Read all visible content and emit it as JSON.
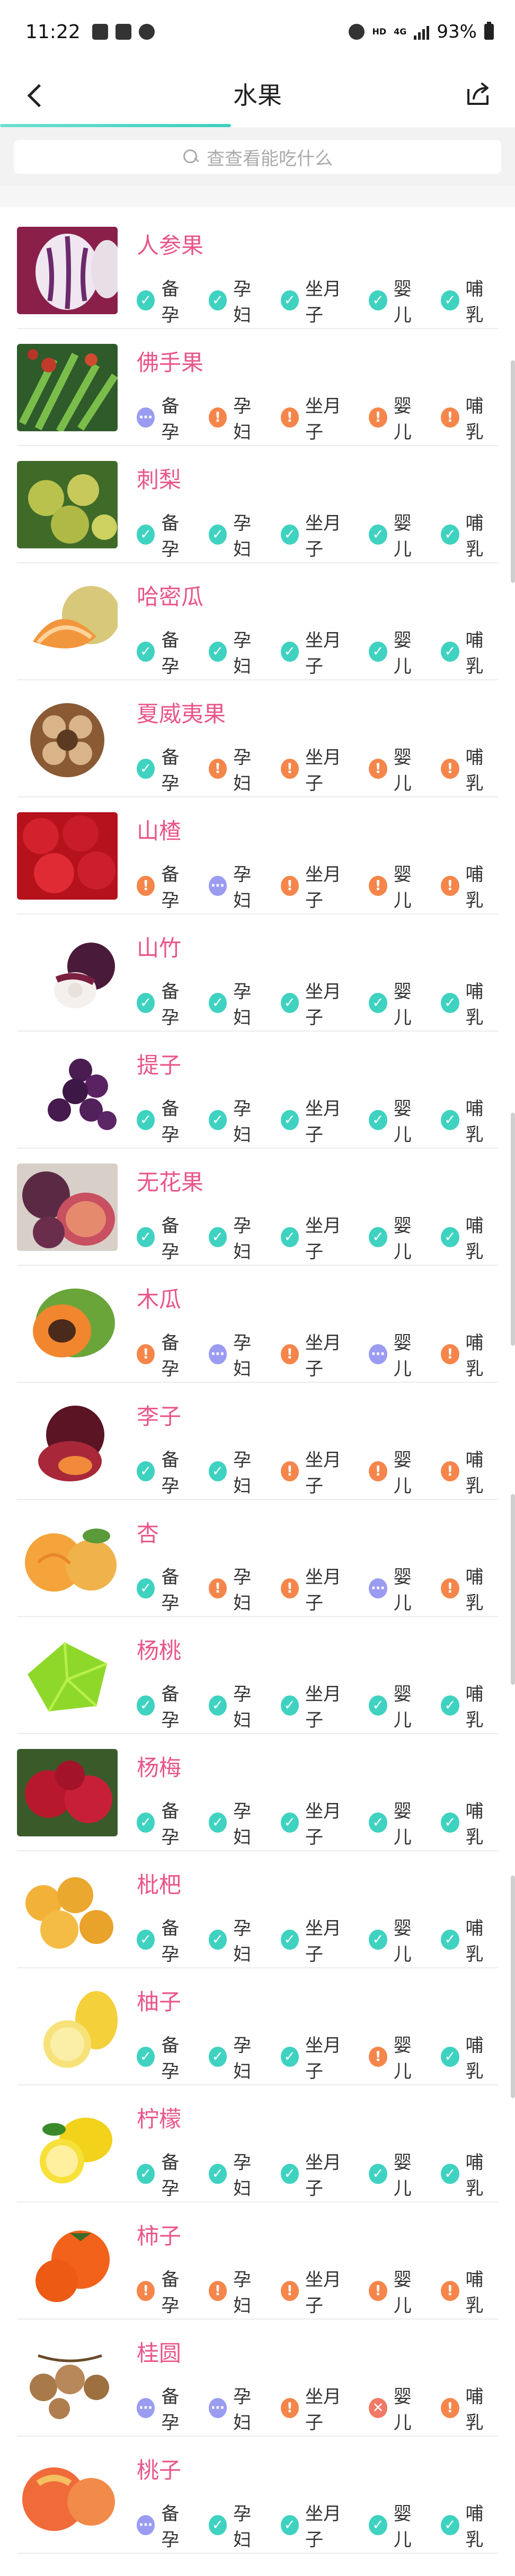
{
  "status_bar": {
    "time": "11:22",
    "network": "HD",
    "network_type": "4G",
    "battery": "93%"
  },
  "nav": {
    "title": "水果",
    "back_icon": "chevron-left-icon",
    "share_icon": "share-icon"
  },
  "search": {
    "placeholder": "查查看能吃什么"
  },
  "status_legend": {
    "ok": {
      "icon": "check-icon",
      "color": "#3fd2c0"
    },
    "warn": {
      "icon": "exclamation-icon",
      "color": "#f5864b"
    },
    "cau": {
      "icon": "ellipsis-icon",
      "color": "#9a9cf2"
    },
    "no": {
      "icon": "cross-icon",
      "color": "#f07a66"
    }
  },
  "categories": [
    "备孕",
    "孕妇",
    "坐月子",
    "婴儿",
    "哺乳"
  ],
  "items": [
    {
      "name": "人参果",
      "statuses": [
        "ok",
        "ok",
        "ok",
        "ok",
        "ok"
      ]
    },
    {
      "name": "佛手果",
      "statuses": [
        "cau",
        "warn",
        "warn",
        "warn",
        "warn"
      ]
    },
    {
      "name": "刺梨",
      "statuses": [
        "ok",
        "ok",
        "ok",
        "ok",
        "ok"
      ]
    },
    {
      "name": "哈密瓜",
      "statuses": [
        "ok",
        "ok",
        "ok",
        "ok",
        "ok"
      ]
    },
    {
      "name": "夏威夷果",
      "statuses": [
        "ok",
        "warn",
        "warn",
        "warn",
        "warn"
      ]
    },
    {
      "name": "山楂",
      "statuses": [
        "warn",
        "cau",
        "warn",
        "warn",
        "warn"
      ]
    },
    {
      "name": "山竹",
      "statuses": [
        "ok",
        "ok",
        "ok",
        "ok",
        "ok"
      ]
    },
    {
      "name": "提子",
      "statuses": [
        "ok",
        "ok",
        "ok",
        "ok",
        "ok"
      ]
    },
    {
      "name": "无花果",
      "statuses": [
        "ok",
        "ok",
        "ok",
        "ok",
        "ok"
      ]
    },
    {
      "name": "木瓜",
      "statuses": [
        "warn",
        "cau",
        "warn",
        "cau",
        "warn"
      ]
    },
    {
      "name": "李子",
      "statuses": [
        "ok",
        "ok",
        "warn",
        "warn",
        "warn"
      ]
    },
    {
      "name": "杏",
      "statuses": [
        "ok",
        "warn",
        "warn",
        "cau",
        "warn"
      ]
    },
    {
      "name": "杨桃",
      "statuses": [
        "ok",
        "ok",
        "ok",
        "ok",
        "ok"
      ]
    },
    {
      "name": "杨梅",
      "statuses": [
        "ok",
        "ok",
        "ok",
        "ok",
        "ok"
      ]
    },
    {
      "name": "枇杷",
      "statuses": [
        "ok",
        "ok",
        "ok",
        "ok",
        "ok"
      ]
    },
    {
      "name": "柚子",
      "statuses": [
        "ok",
        "ok",
        "ok",
        "warn",
        "ok"
      ]
    },
    {
      "name": "柠檬",
      "statuses": [
        "ok",
        "ok",
        "ok",
        "ok",
        "ok"
      ]
    },
    {
      "name": "柿子",
      "statuses": [
        "warn",
        "warn",
        "warn",
        "warn",
        "warn"
      ]
    },
    {
      "name": "桂圆",
      "statuses": [
        "cau",
        "cau",
        "warn",
        "no",
        "warn"
      ]
    },
    {
      "name": "桃子",
      "statuses": [
        "cau",
        "ok",
        "ok",
        "ok",
        "ok"
      ]
    }
  ]
}
